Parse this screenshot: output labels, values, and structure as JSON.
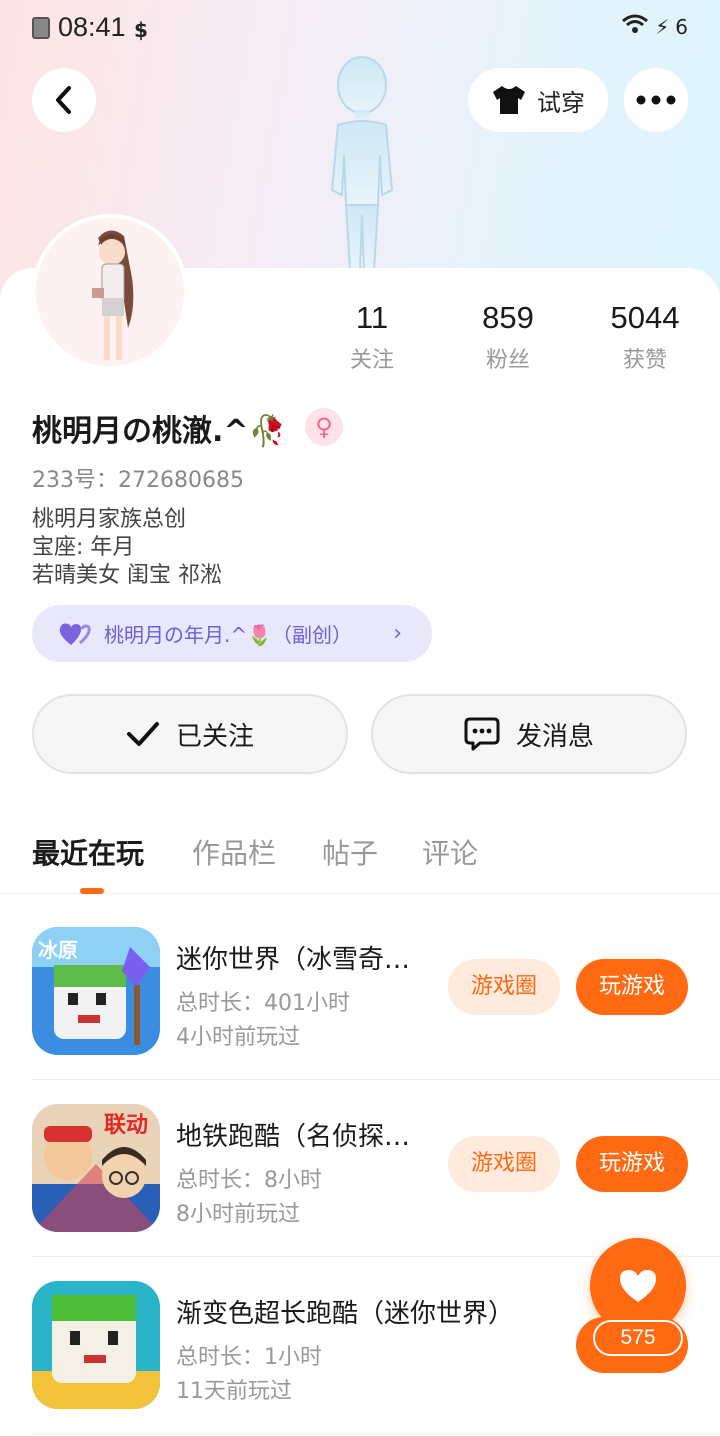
{
  "status_bar": {
    "time": "08:41",
    "battery": "6"
  },
  "header": {
    "tryon_label": "试穿"
  },
  "stats": [
    {
      "value": "11",
      "label": "关注"
    },
    {
      "value": "859",
      "label": "粉丝"
    },
    {
      "value": "5044",
      "label": "获赞"
    }
  ],
  "profile": {
    "name": "桃明月の桃澈.^🥀",
    "gender_symbol": "♀",
    "uid": "233号：272680685",
    "bio_lines": [
      "桃明月家族总创",
      "宝座: 年月",
      "若晴美女 闺宝 祁淞"
    ]
  },
  "family": {
    "label": "桃明月の年月.^🌷（副创）"
  },
  "actions": {
    "follow_label": "已关注",
    "message_label": "发消息"
  },
  "tabs": [
    "最近在玩",
    "作品栏",
    "帖子",
    "评论"
  ],
  "games": [
    {
      "title": "迷你世界（冰雪奇…",
      "duration": "总时长：401小时",
      "last_played": "4小时前玩过",
      "circle_label": "游戏圈",
      "play_label": "玩游戏"
    },
    {
      "title": "地铁跑酷（名侦探…",
      "duration": "总时长：8小时",
      "last_played": "8小时前玩过",
      "circle_label": "游戏圈",
      "play_label": "玩游戏"
    },
    {
      "title": "渐变色超长跑酷（迷你世界）",
      "duration": "总时长：1小时",
      "last_played": "11天前玩过"
    }
  ],
  "like_fab": {
    "count": "575"
  },
  "colors": {
    "accent": "#ff6a13",
    "accent_soft": "#ffeade",
    "family_pill": "#e9e8fb"
  }
}
